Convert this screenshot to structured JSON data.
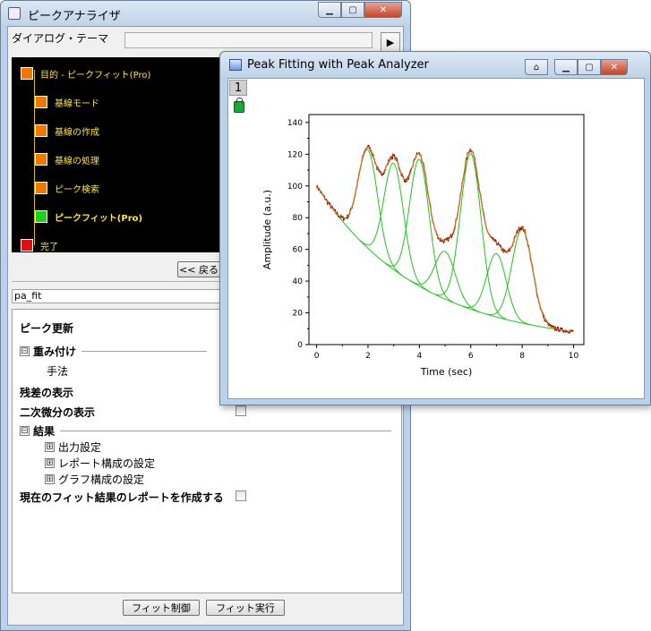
{
  "analyzer": {
    "title": "ピークアナライザ",
    "theme_label": "ダイアログ・テーマ",
    "theme_value": "",
    "theme_arrow": "▶",
    "flow": [
      {
        "label": "目的 - ピークフィット(Pro)",
        "color": "#f07800",
        "active": false
      },
      {
        "label": "基線モード",
        "color": "#f07800",
        "active": false
      },
      {
        "label": "基線の作成",
        "color": "#f07800",
        "active": false
      },
      {
        "label": "基線の処理",
        "color": "#f07800",
        "active": false
      },
      {
        "label": "ピーク検索",
        "color": "#f07800",
        "active": false
      },
      {
        "label": "ピークフィット(Pro)",
        "color": "#20d020",
        "active": true
      },
      {
        "label": "完了",
        "color": "#e01010",
        "active": false
      }
    ],
    "back_button": "<< 戻る",
    "dataset": "pa_fit",
    "settings": {
      "peak_update": "ピーク更新",
      "weighting": "重み付け",
      "method": "手法",
      "residuals": "残差の表示",
      "second_derivative": "二次微分の表示",
      "results": "結果",
      "output_settings": "出力設定",
      "report_settings": "レポート構成の設定",
      "graph_settings": "グラフ構成の設定",
      "create_report": "現在のフィット結果のレポートを作成する",
      "expand_symbol": "⊞",
      "collapse_symbol": "⊟"
    },
    "fit_control_button": "フィット制御",
    "fit_run_button": "フィット実行"
  },
  "graph": {
    "title": "Peak Fitting with Peak Analyzer",
    "layer_tab": "1"
  },
  "chart_data": {
    "type": "line",
    "title": "",
    "xlabel": "Time (sec)",
    "ylabel": "Amplitude (a.u.)",
    "xlim": [
      -0.3,
      10.4
    ],
    "ylim": [
      0,
      145
    ],
    "xticks": [
      0,
      2,
      4,
      6,
      8,
      10
    ],
    "yticks": [
      0,
      20,
      40,
      60,
      80,
      100,
      120,
      140
    ],
    "baseline": {
      "A": 100,
      "tau": 4.0
    },
    "peaks": [
      {
        "center": 2.0,
        "amplitude": 62,
        "width": 0.38
      },
      {
        "center": 3.0,
        "amplitude": 67,
        "width": 0.38
      },
      {
        "center": 4.0,
        "amplitude": 80,
        "width": 0.38
      },
      {
        "center": 5.0,
        "amplitude": 30,
        "width": 0.4
      },
      {
        "center": 6.0,
        "amplitude": 98,
        "width": 0.4
      },
      {
        "center": 7.0,
        "amplitude": 40,
        "width": 0.38
      },
      {
        "center": 8.0,
        "amplitude": 59,
        "width": 0.4
      }
    ],
    "x_range": [
      0,
      10
    ],
    "series": [
      {
        "name": "",
        "color": "#7a0000",
        "role": "data"
      },
      {
        "name": "",
        "color": "#e08020",
        "role": "cumulative fit"
      },
      {
        "name": "",
        "color": "#22c322",
        "role": "baseline and peaks"
      }
    ],
    "grid": false,
    "legend": false
  }
}
